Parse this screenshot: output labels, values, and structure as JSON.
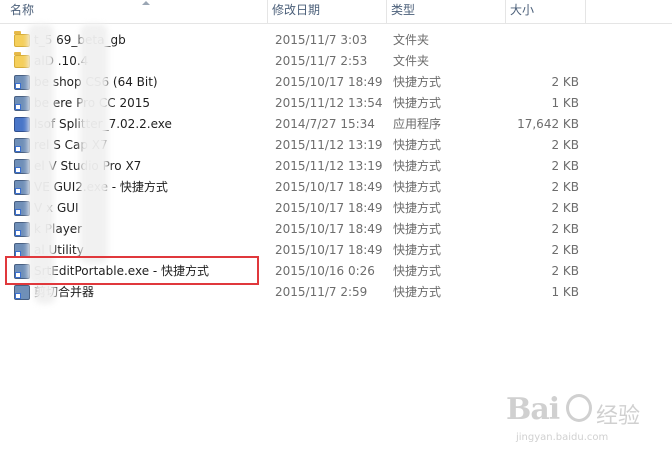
{
  "columns": {
    "name": "名称",
    "date": "修改日期",
    "type": "类型",
    "size": "大小"
  },
  "files": [
    {
      "name": "t_5   69_beta_gb",
      "date": "2015/11/7 3:03",
      "type": "文件夹",
      "size": "",
      "icon": "folder-icon"
    },
    {
      "name": "alD   .10.4",
      "date": "2015/11/7 2:53",
      "type": "文件夹",
      "size": "",
      "icon": "folder-icon"
    },
    {
      "name": "be   shop CS6 (64 Bit)",
      "date": "2015/10/17 18:49",
      "type": "快捷方式",
      "size": "2 KB",
      "icon": "shortcut-icon"
    },
    {
      "name": "be   ere Pro CC 2015",
      "date": "2015/11/12 13:54",
      "type": "快捷方式",
      "size": "1 KB",
      "icon": "shortcut-icon"
    },
    {
      "name": "lsof   Splitter_7.02.2.exe",
      "date": "2014/7/27 15:34",
      "type": "应用程序",
      "size": "17,642 KB",
      "icon": "app-icon"
    },
    {
      "name": "rel S   Cap X7",
      "date": "2015/11/12 13:19",
      "type": "快捷方式",
      "size": "2 KB",
      "icon": "shortcut-icon"
    },
    {
      "name": "el V   Studio Pro X7",
      "date": "2015/11/12 13:19",
      "type": "快捷方式",
      "size": "2 KB",
      "icon": "shortcut-icon"
    },
    {
      "name": "VE   GUI2.exe - 快捷方式",
      "date": "2015/10/17 18:49",
      "type": "快捷方式",
      "size": "2 KB",
      "icon": "shortcut-icon"
    },
    {
      "name": "V   x GUI",
      "date": "2015/10/17 18:49",
      "type": "快捷方式",
      "size": "2 KB",
      "icon": "shortcut-icon"
    },
    {
      "name": "k   Player",
      "date": "2015/10/17 18:49",
      "type": "快捷方式",
      "size": "2 KB",
      "icon": "shortcut-icon"
    },
    {
      "name": "al   Utility",
      "date": "2015/10/17 18:49",
      "type": "快捷方式",
      "size": "2 KB",
      "icon": "shortcut-icon"
    },
    {
      "name": "SrtEditPortable.exe - 快捷方式",
      "date": "2015/10/16 0:26",
      "type": "快捷方式",
      "size": "2 KB",
      "icon": "shortcut-icon"
    },
    {
      "name": "剪切合并器",
      "date": "2015/11/7 2:59",
      "type": "快捷方式",
      "size": "1 KB",
      "icon": "shortcut-icon"
    }
  ],
  "watermark": {
    "logo": "Bai",
    "chinese": "经验",
    "url": "jingyan.baidu.com"
  }
}
